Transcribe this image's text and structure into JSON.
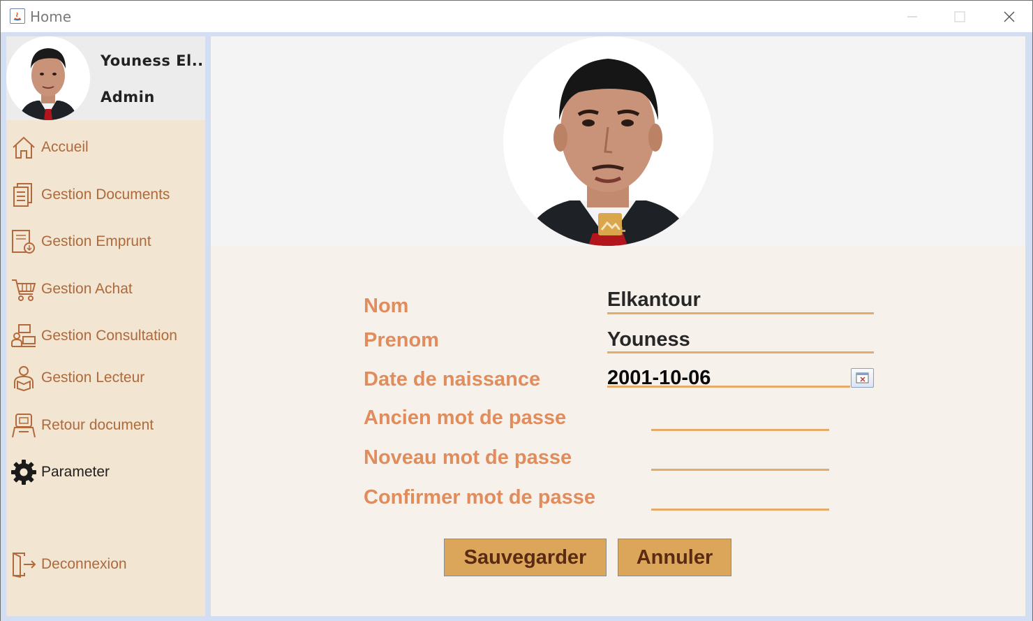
{
  "window": {
    "title": "Home",
    "controls": [
      "minimize",
      "maximize",
      "close"
    ]
  },
  "user": {
    "name": "Youness El..",
    "role": "Admin",
    "avatar": "user-photo"
  },
  "sidebar": {
    "items": [
      {
        "label": "Accueil",
        "icon": "home-icon"
      },
      {
        "label": "Gestion Documents",
        "icon": "documents-icon"
      },
      {
        "label": "Gestion Emprunt",
        "icon": "borrow-icon"
      },
      {
        "label": "Gestion Achat",
        "icon": "cart-icon"
      },
      {
        "label": "Gestion Consultation",
        "icon": "consultation-icon"
      },
      {
        "label": "Gestion Lecteur",
        "icon": "reader-icon"
      },
      {
        "label": "Retour document",
        "icon": "return-icon"
      },
      {
        "label": "Parameter",
        "icon": "gear-icon",
        "active": true
      }
    ],
    "logout": {
      "label": "Deconnexion",
      "icon": "logout-icon"
    }
  },
  "form": {
    "nom": {
      "label": "Nom",
      "value": "Elkantour"
    },
    "prenom": {
      "label": "Prenom",
      "value": "Youness"
    },
    "date_naissance": {
      "label": "Date de naissance",
      "value": "2001-10-06"
    },
    "ancien_mdp": {
      "label": "Ancien mot de passe",
      "value": ""
    },
    "nouveau_mdp": {
      "label": "Noveau mot de passe",
      "value": ""
    },
    "confirmer_mdp": {
      "label": "Confirmer mot de passe",
      "value": ""
    }
  },
  "actions": {
    "save_label": "Sauvegarder",
    "cancel_label": "Annuler"
  },
  "colors": {
    "sidebar_bg": "#f2e5d2",
    "accent_label": "#e08c5c",
    "nav_text": "#ad6a3c",
    "underline": "#e3ac6a",
    "button_bg": "#dba65a",
    "button_text": "#5a2a12"
  }
}
